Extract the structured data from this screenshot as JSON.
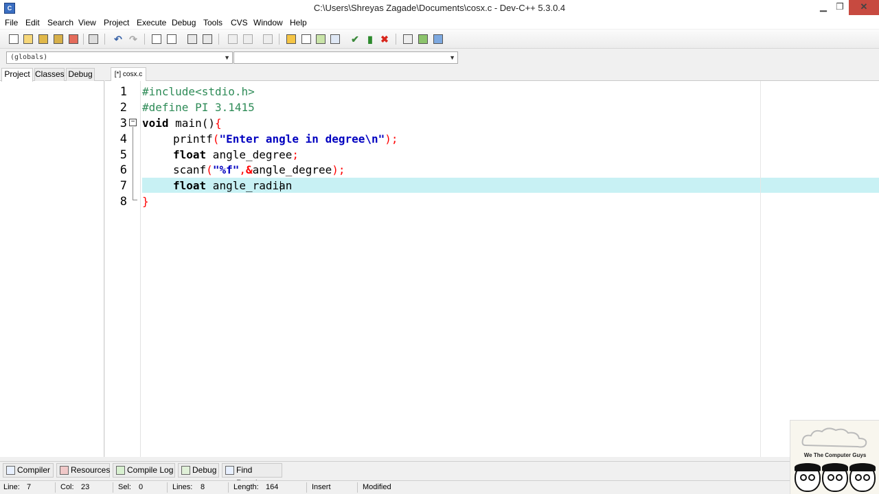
{
  "window": {
    "title": "C:\\Users\\Shreyas Zagade\\Documents\\cosx.c - Dev-C++ 5.3.0.4",
    "minimize": "▁",
    "maximize": "❐",
    "close": "✕"
  },
  "menu": [
    "File",
    "Edit",
    "Search",
    "View",
    "Project",
    "Execute",
    "Debug",
    "Tools",
    "CVS",
    "Window",
    "Help"
  ],
  "scope": {
    "left_value": "(globals)",
    "right_value": ""
  },
  "left_tabs": [
    "Project",
    "Classes",
    "Debug"
  ],
  "editor_tab": "[*] cosx.c",
  "line_numbers": [
    "1",
    "2",
    "3",
    "4",
    "5",
    "6",
    "7",
    "8"
  ],
  "code": {
    "l1": "#include<stdio.h>",
    "l2": "#define PI 3.1415",
    "l3_kw": "void",
    "l3_rest": " main()",
    "l3_brace": "{",
    "l4_fn": "printf",
    "l4_open": "(",
    "l4_str": "\"Enter angle in degree\\n\"",
    "l4_close": ");",
    "l5_kw": "float",
    "l5_rest": " angle_degree",
    "l5_semi": ";",
    "l6_fn": "scanf",
    "l6_open": "(",
    "l6_str": "\"%f\"",
    "l6_comma": ",",
    "l6_amp": "&",
    "l6_rest": "angle_degree",
    "l6_close": ");",
    "l7_kw": "float",
    "l7_rest": " angle_radian",
    "l8": "}"
  },
  "bottom_tabs": [
    "Compiler",
    "Resources",
    "Compile Log",
    "Debug",
    "Find Results"
  ],
  "status": {
    "line_label": "Line:",
    "line_value": "7",
    "col_label": "Col:",
    "col_value": "23",
    "sel_label": "Sel:",
    "sel_value": "0",
    "lines_label": "Lines:",
    "lines_value": "8",
    "length_label": "Length:",
    "length_value": "164",
    "mode": "Insert",
    "state": "Modified"
  },
  "logo_text": "We The Computer Guys",
  "colors": {
    "current_line": "#c8f1f4",
    "preprocessor": "#2e8b57",
    "string": "#0000c0",
    "symbol": "#ff0000",
    "close_button": "#c74a40"
  }
}
